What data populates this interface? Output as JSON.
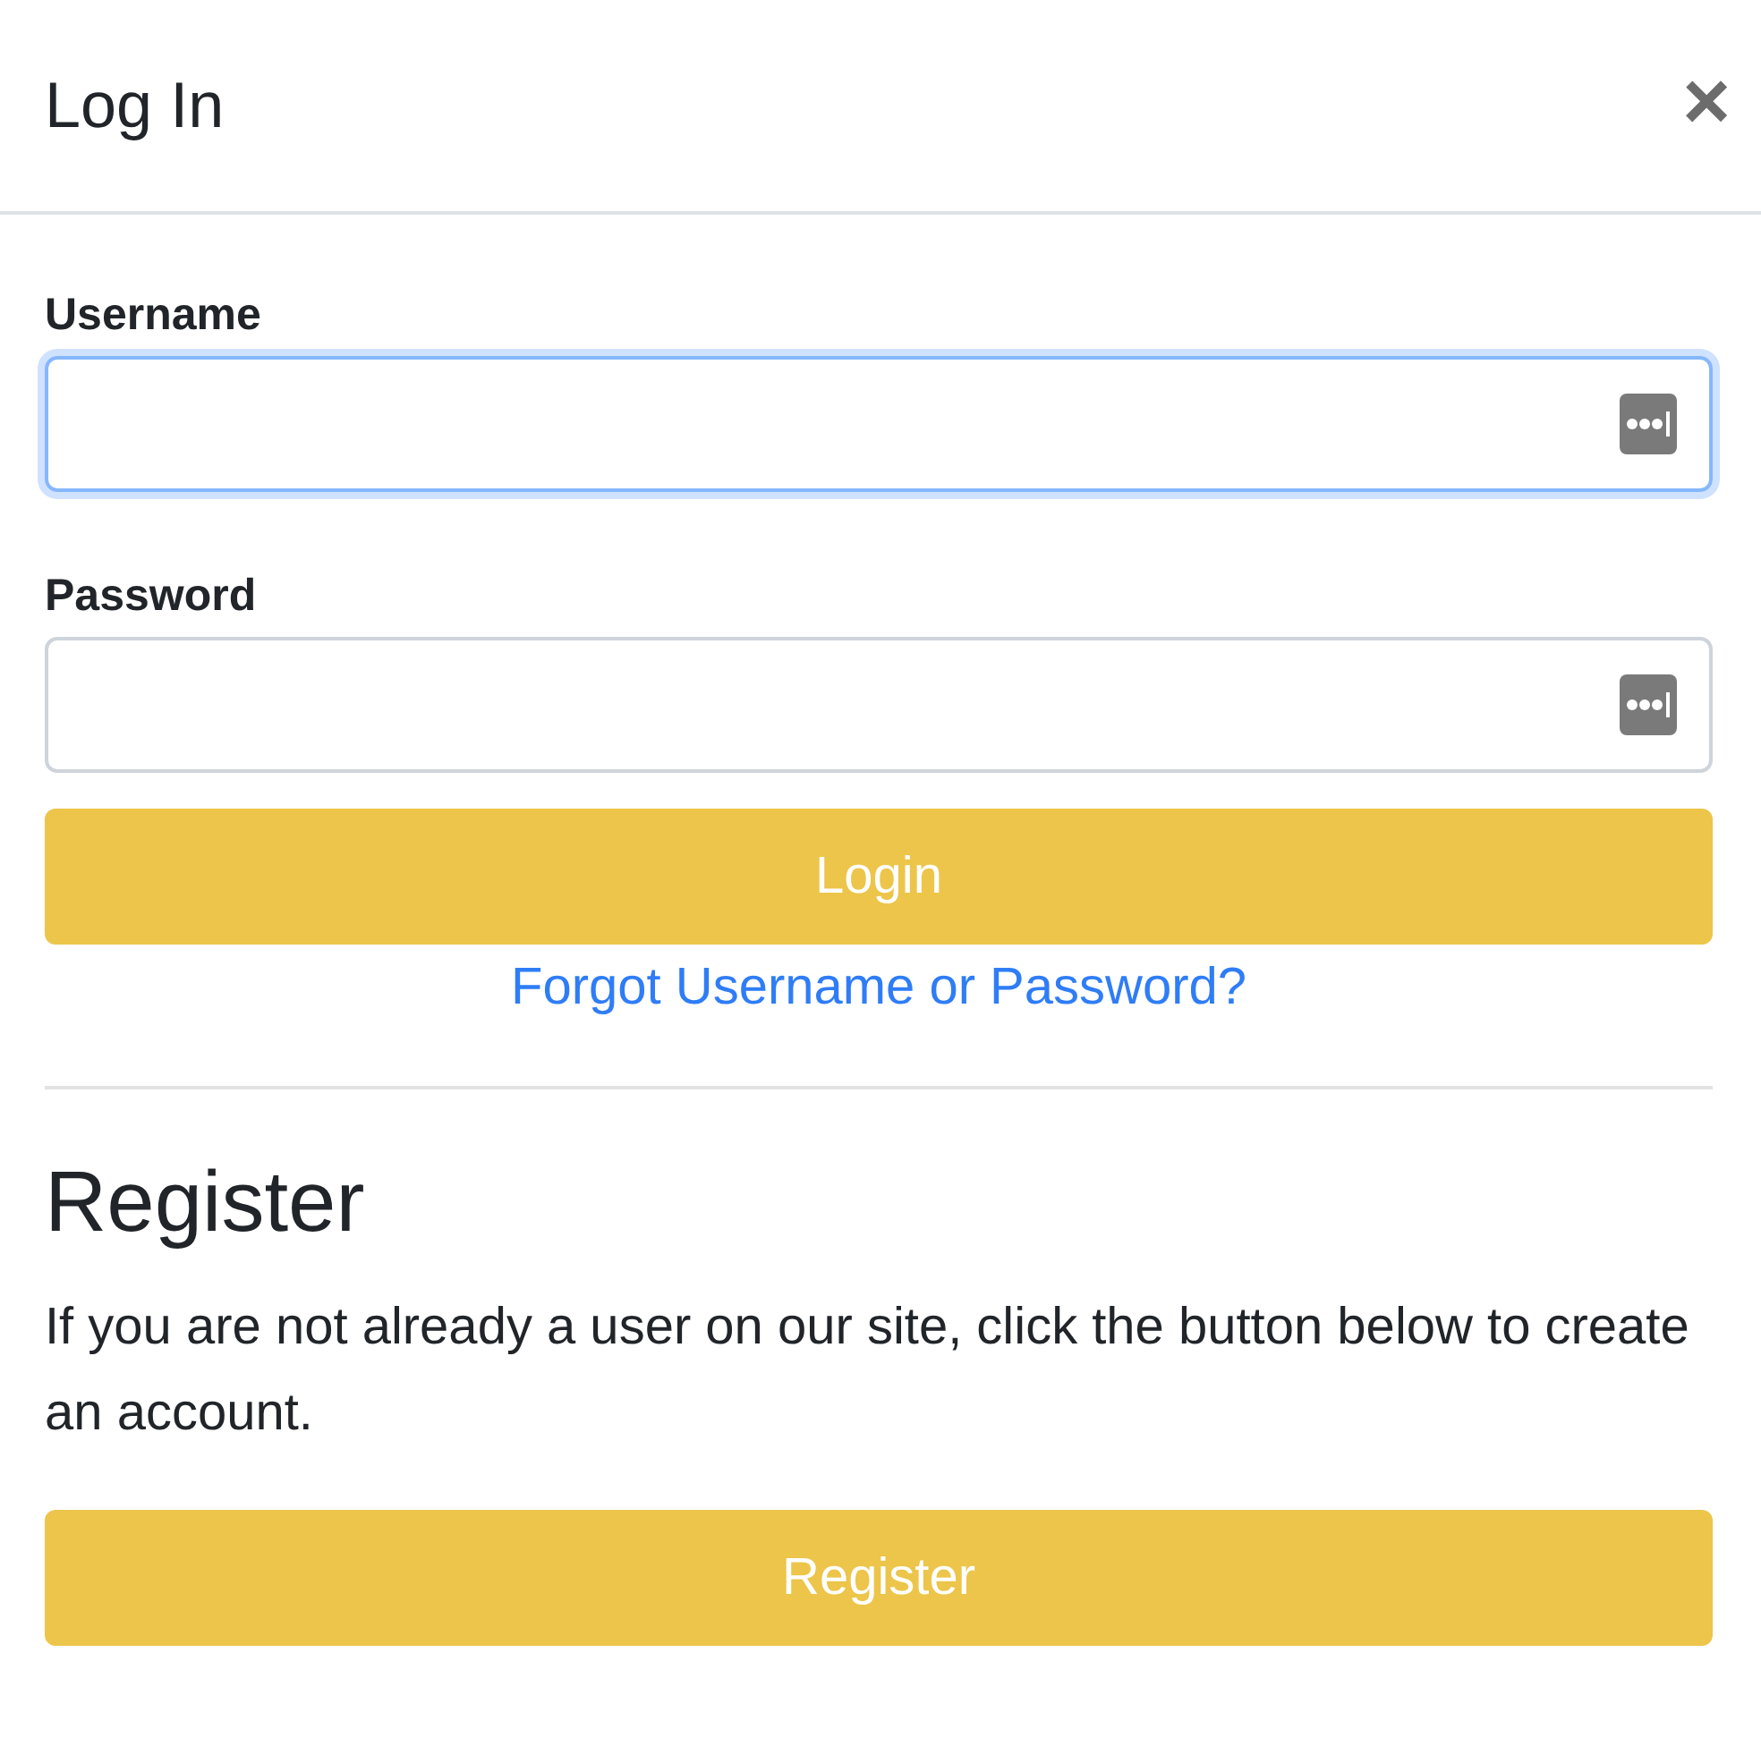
{
  "header": {
    "title": "Log In",
    "close": "×"
  },
  "login": {
    "fields": [
      {
        "label": "Username",
        "focused": true
      },
      {
        "label": "Password",
        "focused": false
      }
    ],
    "button": "Login",
    "link": "Forgot Username or Password?"
  },
  "register": {
    "heading": "Register",
    "text": "If you are not already a user on our site, click the button below to create an account.",
    "button": "Register"
  }
}
